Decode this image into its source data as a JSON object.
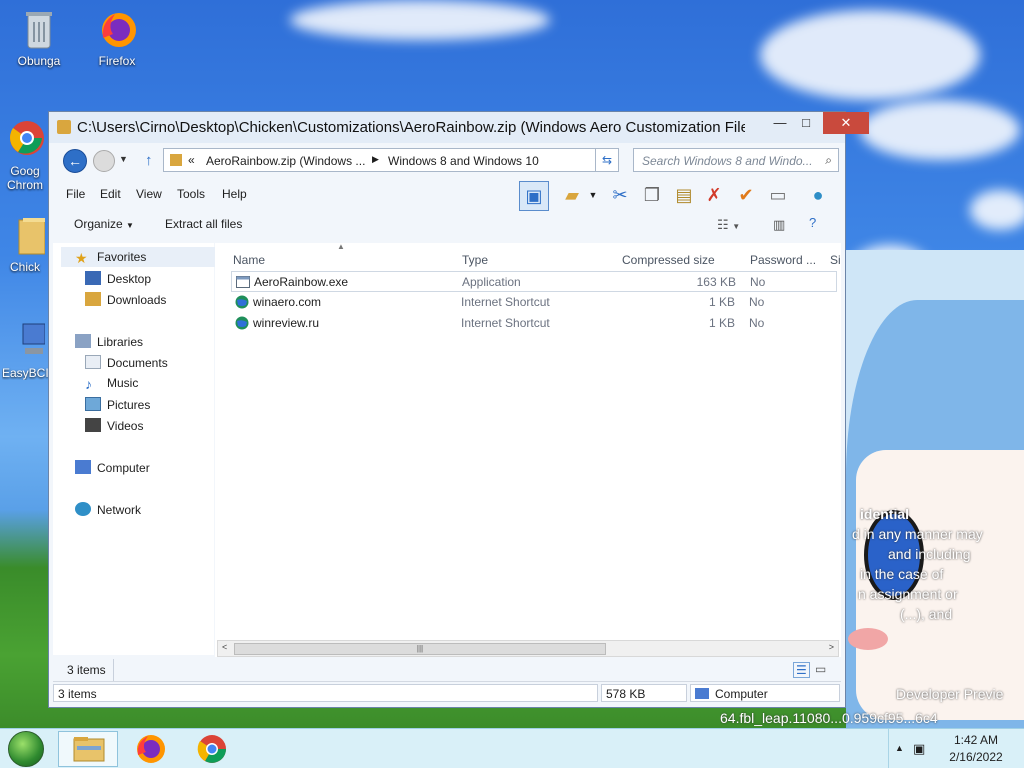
{
  "desktop": {
    "icons": [
      {
        "label": "Obunga"
      },
      {
        "label": "Firefox"
      },
      {
        "label": "Goog Chrom"
      },
      {
        "label": "Chick"
      },
      {
        "label": "EasyBCI"
      }
    ],
    "watermark": {
      "line1": "idential",
      "line2": "d in any manner may",
      "line3": "and including",
      "line4": "in the case of",
      "line5": "n assignment or",
      "line6": "(...), and",
      "line7": "Developer Previe",
      "line8": "64.fbl_leap.11080...0.959cf95...6c4"
    }
  },
  "window": {
    "title": "C:\\Users\\Cirno\\Desktop\\Chicken\\Customizations\\AeroRainbow.zip (Windows Aero Customization File.",
    "controls": {
      "minimize": "—",
      "maximize": "□",
      "close": "✕"
    },
    "address": {
      "chevron": "«",
      "segment1": "AeroRainbow.zip (Windows ...",
      "separator": "▶",
      "segment2": "Windows 8 and Windows 10"
    },
    "search": {
      "placeholder": "Search Windows 8 and Windo..."
    },
    "menu": [
      "File",
      "Edit",
      "View",
      "Tools",
      "Help"
    ],
    "commands": {
      "organize": "Organize",
      "extract": "Extract all files"
    },
    "nav": {
      "favorites": "Favorites",
      "desktop": "Desktop",
      "downloads": "Downloads",
      "libraries": "Libraries",
      "documents": "Documents",
      "music": "Music",
      "pictures": "Pictures",
      "videos": "Videos",
      "computer": "Computer",
      "network": "Network"
    },
    "columns": {
      "name": "Name",
      "type": "Type",
      "size": "Compressed size",
      "password": "Password ...",
      "extra": "Si"
    },
    "files": [
      {
        "name": "AeroRainbow.exe",
        "type": "Application",
        "size": "163 KB",
        "password": "No",
        "icon": "application-icon"
      },
      {
        "name": "winaero.com",
        "type": "Internet Shortcut",
        "size": "1 KB",
        "password": "No",
        "icon": "globe-icon"
      },
      {
        "name": "winreview.ru",
        "type": "Internet Shortcut",
        "size": "1 KB",
        "password": "No",
        "icon": "globe-icon"
      }
    ],
    "details": {
      "count": "3 items"
    },
    "status": {
      "count": "3 items",
      "size": "578 KB",
      "location": "Computer"
    }
  },
  "taskbar": {
    "time": "1:42 AM",
    "date": "2/16/2022"
  },
  "colors": {
    "accent": "#2e6fc7",
    "close": "#c94a3d",
    "folder": "#d9a63e"
  }
}
